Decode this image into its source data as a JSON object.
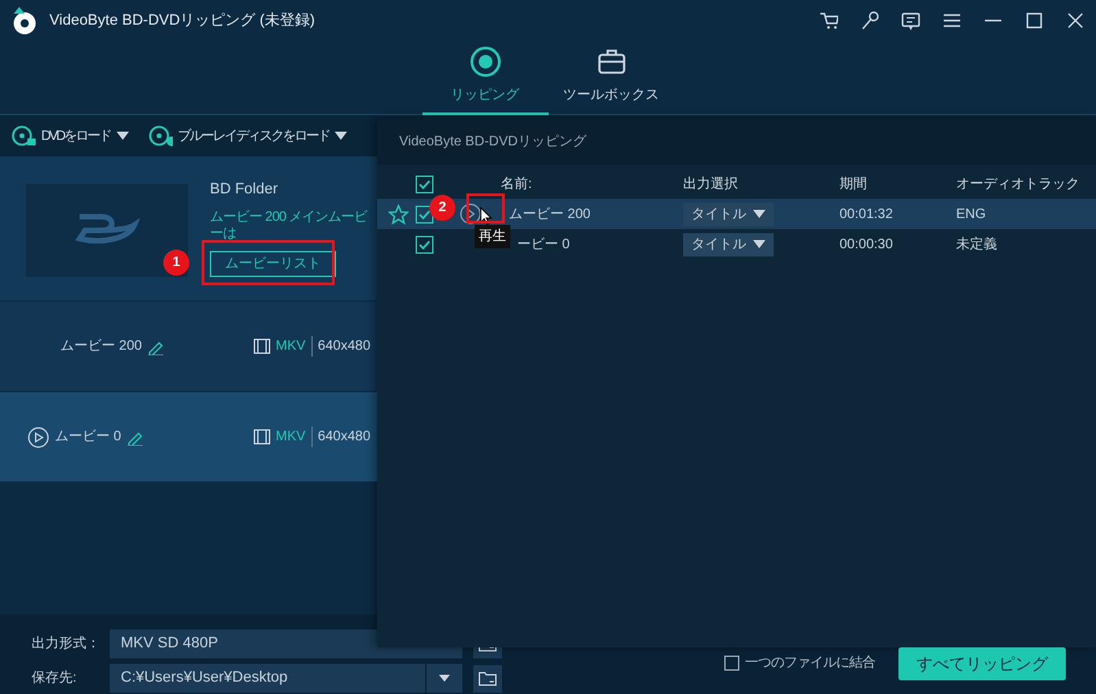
{
  "window": {
    "title": "VideoByte BD-DVDリッピング (未登録)"
  },
  "tabs": [
    {
      "label": "リッピング",
      "selected": true
    },
    {
      "label": "ツールボックス",
      "selected": false
    }
  ],
  "toolbar": [
    {
      "label": "DVDをロード",
      "kind": "dvd"
    },
    {
      "label": "ブルーレイディスクをロード",
      "kind": "bluray"
    }
  ],
  "source": {
    "name": "BD Folder",
    "info": "ムービー 200 メインムービーは",
    "button": "ムービーリスト"
  },
  "titles": [
    {
      "name": "ムービー 200",
      "format": "MKV",
      "resolution": "640x480",
      "selected": false
    },
    {
      "name": "ムービー 0",
      "format": "MKV",
      "resolution": "640x480",
      "selected": true
    }
  ],
  "output": {
    "format_label": "出力形式：",
    "format": "MKV SD 480P",
    "save_label": "保存先:",
    "path": "C:¥Users¥User¥Desktop"
  },
  "merge": {
    "label": "一つのファイルに結合",
    "checked": false
  },
  "rip_button": "すべてリッピング",
  "dialog": {
    "title": "VideoByte BD-DVDリッピング",
    "all_checked": true,
    "columns": [
      "名前:",
      "出力選択",
      "期間",
      "オーディオトラック"
    ],
    "rows": [
      {
        "name": "ムービー 200",
        "output": "タイトル",
        "duration": "00:01:32",
        "audio": "ENG",
        "checked": true,
        "selected": true
      },
      {
        "name": "ービー 0",
        "output": "タイトル",
        "duration": "00:00:30",
        "audio": "未定義",
        "checked": true,
        "selected": false
      }
    ],
    "tooltip": "再生"
  },
  "annotations": [
    {
      "number": "1"
    },
    {
      "number": "2"
    }
  ]
}
